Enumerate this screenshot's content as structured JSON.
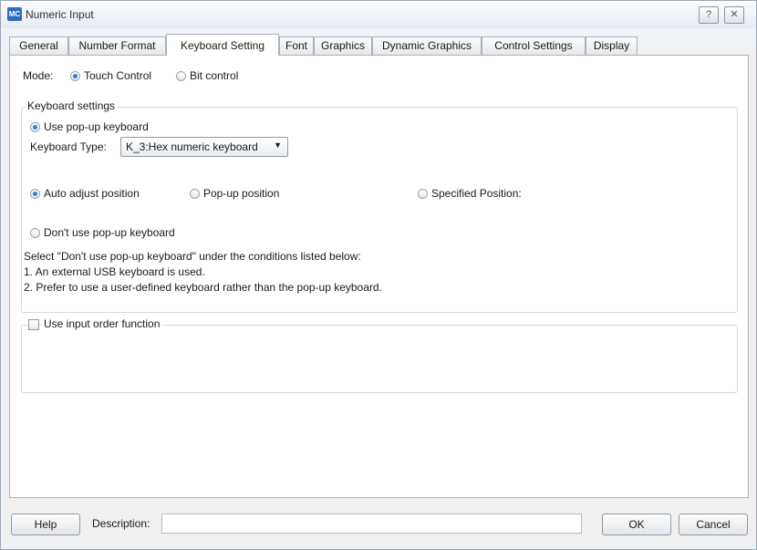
{
  "window": {
    "app_icon": "MC",
    "title": "Numeric Input",
    "help_symbol": "?",
    "close_symbol": "✕"
  },
  "tabs": [
    {
      "label": "General"
    },
    {
      "label": "Number Format"
    },
    {
      "label": "Keyboard Setting",
      "active": true
    },
    {
      "label": "Font"
    },
    {
      "label": "Graphics"
    },
    {
      "label": "Dynamic Graphics"
    },
    {
      "label": "Control Settings"
    },
    {
      "label": "Display"
    }
  ],
  "mode": {
    "label": "Mode:",
    "options": [
      {
        "label": "Touch Control",
        "checked": true
      },
      {
        "label": "Bit control",
        "checked": false
      }
    ]
  },
  "keyboard_settings": {
    "legend": "Keyboard settings",
    "use_popup_label": "Use pop-up keyboard",
    "use_popup_checked": true,
    "keyboard_type_label": "Keyboard Type:",
    "keyboard_type_value": "K_3:Hex numeric keyboard",
    "position_options": [
      {
        "label": "Auto adjust position",
        "checked": true
      },
      {
        "label": "Pop-up position",
        "checked": false
      },
      {
        "label": "Specified Position:",
        "checked": false
      }
    ],
    "dont_use_popup_label": "Don't use pop-up keyboard",
    "dont_use_popup_checked": false,
    "info_lines": [
      "Select \"Don't use pop-up keyboard\" under the conditions listed below:",
      "1. An external USB keyboard is used.",
      "2. Prefer to use a user-defined keyboard rather than the pop-up keyboard."
    ]
  },
  "input_order": {
    "label": "Use input order function",
    "checked": false
  },
  "footer": {
    "help_label": "Help",
    "description_label": "Description:",
    "description_value": "",
    "ok_label": "OK",
    "cancel_label": "Cancel"
  },
  "colors": {
    "radio_selected": "#2f7be0",
    "app_icon_bg": "#2f6bb8"
  }
}
